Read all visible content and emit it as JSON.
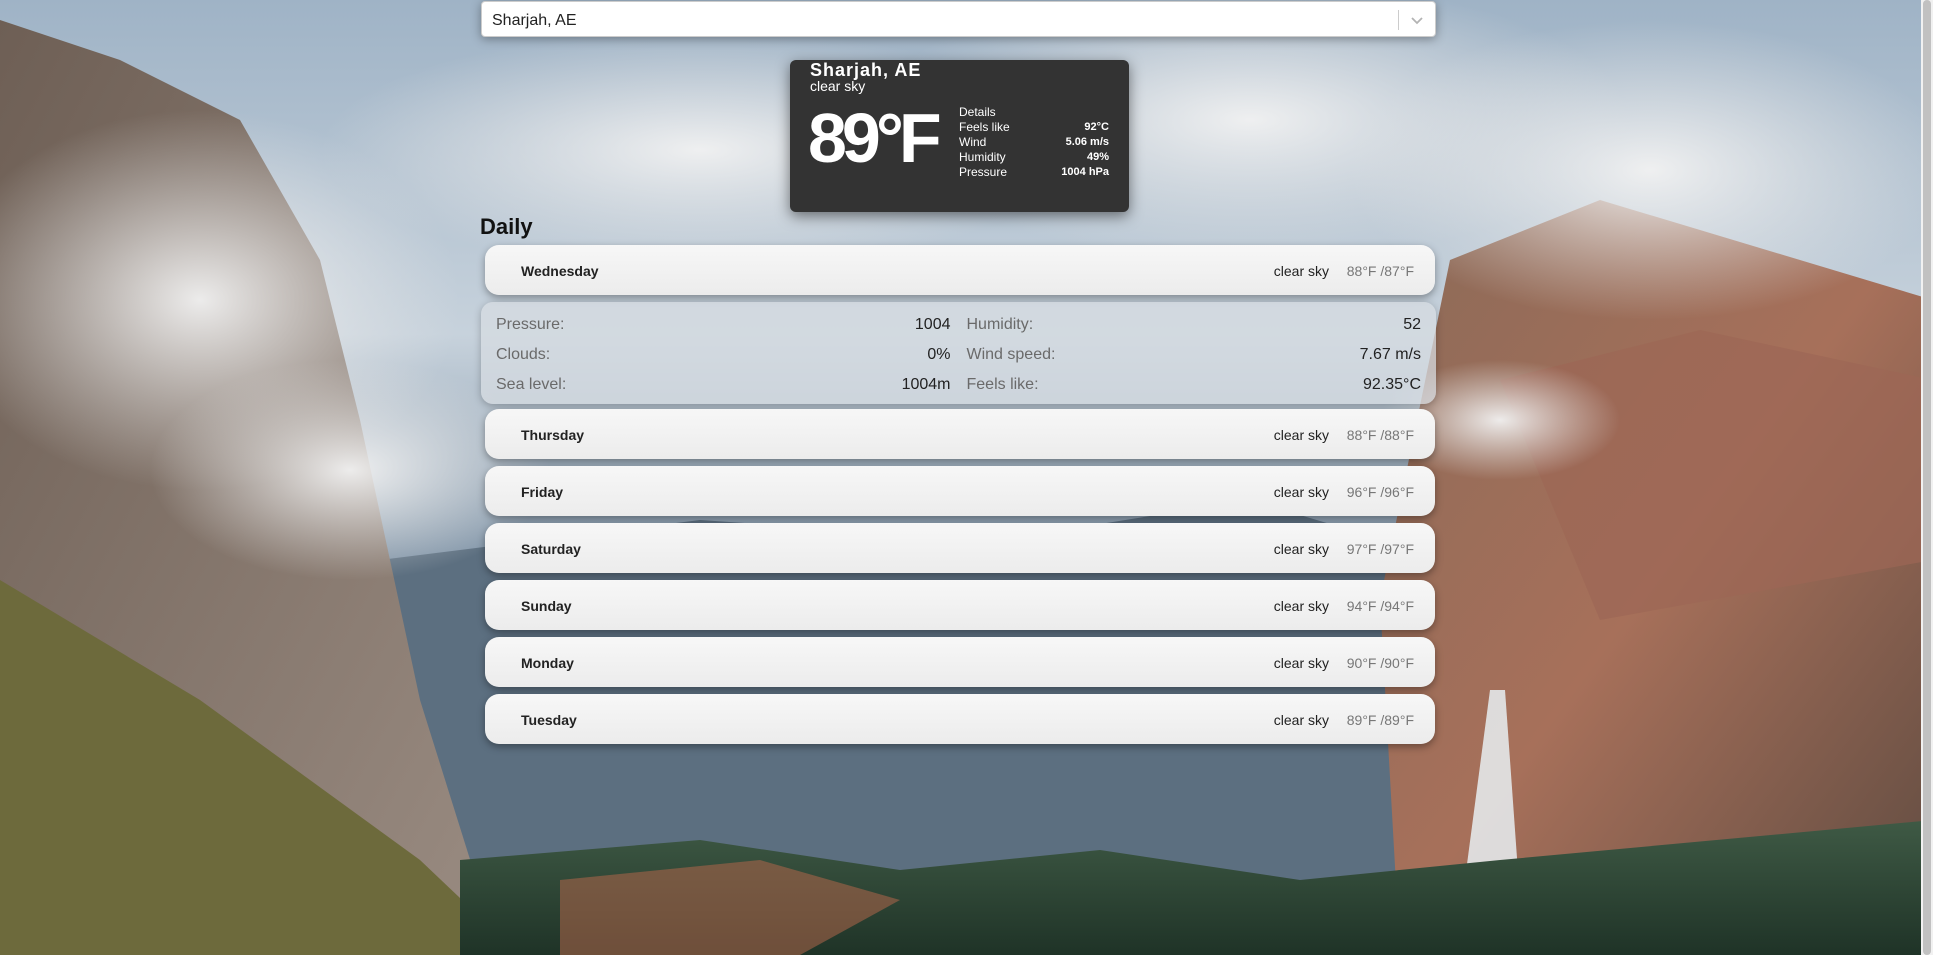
{
  "search": {
    "selected_value": "Sharjah, AE",
    "chevron_icon": "chevron-down-icon"
  },
  "current": {
    "city": "Sharjah, AE",
    "description": "clear sky",
    "temperature": "89°F",
    "details_heading": "Details",
    "details": [
      {
        "label": "Feels like",
        "value": "92°C"
      },
      {
        "label": "Wind",
        "value": "5.06 m/s"
      },
      {
        "label": "Humidity",
        "value": "49%"
      },
      {
        "label": "Pressure",
        "value": "1004 hPa"
      }
    ]
  },
  "daily": {
    "title": "Daily",
    "days": [
      {
        "day": "Wednesday",
        "description": "clear sky",
        "minmax": "88°F /87°F"
      },
      {
        "day": "Thursday",
        "description": "clear sky",
        "minmax": "88°F /88°F"
      },
      {
        "day": "Friday",
        "description": "clear sky",
        "minmax": "96°F /96°F"
      },
      {
        "day": "Saturday",
        "description": "clear sky",
        "minmax": "97°F /97°F"
      },
      {
        "day": "Sunday",
        "description": "clear sky",
        "minmax": "94°F /94°F"
      },
      {
        "day": "Monday",
        "description": "clear sky",
        "minmax": "90°F /90°F"
      },
      {
        "day": "Tuesday",
        "description": "clear sky",
        "minmax": "89°F /89°F"
      }
    ],
    "expanded": {
      "pressure_label": "Pressure:",
      "pressure_value": "1004",
      "humidity_label": "Humidity:",
      "humidity_value": "52",
      "clouds_label": "Clouds:",
      "clouds_value": "0%",
      "wind_label": "Wind speed:",
      "wind_value": "7.67 m/s",
      "sea_label": "Sea level:",
      "sea_value": "1004m",
      "feels_label": "Feels like:",
      "feels_value": "92.35°C"
    }
  },
  "colors": {
    "card_bg": "#333333",
    "item_bg": "#f2f2f2",
    "muted_text": "#777777"
  }
}
